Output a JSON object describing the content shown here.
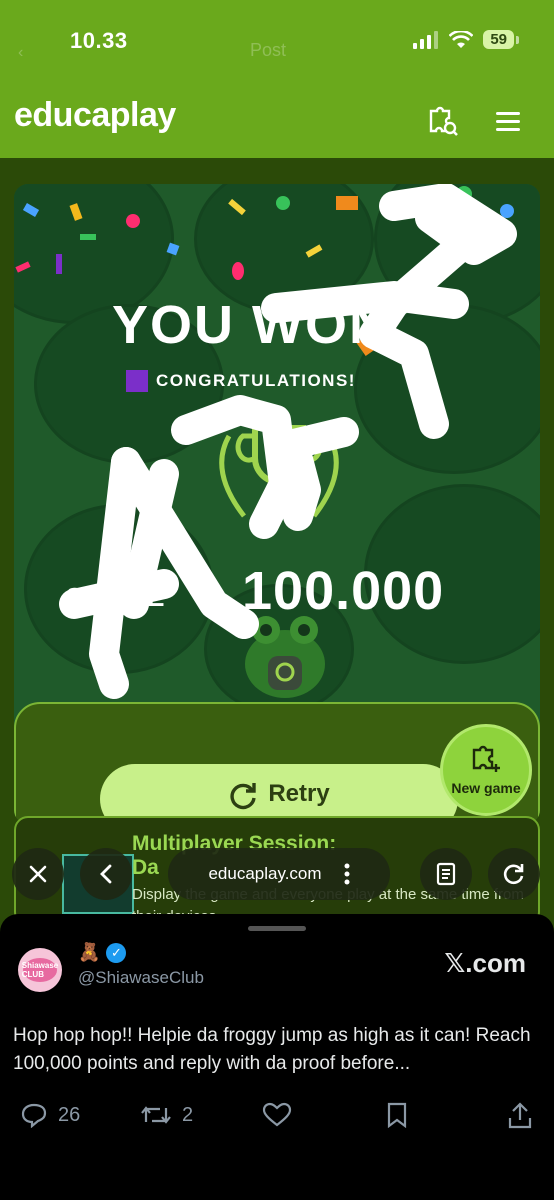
{
  "status_bar": {
    "time": "10.33",
    "battery": "59",
    "faded_text": "Post"
  },
  "header": {
    "brand": "educaplay",
    "search_icon": "puzzle-search-icon",
    "menu_icon": "hamburger-menu-icon"
  },
  "result": {
    "headline": "YOU WON",
    "congrats": "CONGRATULATIONS!",
    "score_label": "SCORE",
    "score_value": "100.000"
  },
  "actions": {
    "retry_label": "Retry",
    "new_game_label": "New game"
  },
  "multiplayer": {
    "title_line1": "Multiplayer Session:",
    "title_line2": "Da",
    "description": "Display the game and everyone play at the same time from their devices"
  },
  "browser": {
    "url": "educaplay.com"
  },
  "tweet": {
    "avatar_text": "Shiawase CLUB",
    "name_emoji": "🧸",
    "handle": "@ShiawaseClub",
    "source": "𝕏.com",
    "text": "Hop hop hop!! Helpie da froggy jump as high as it can! Reach 100,000 points and reply with da proof before...",
    "replies": "26",
    "reposts": "2"
  },
  "colors": {
    "brand_green": "#6aa91c",
    "game_bg": "#1f5a2a",
    "retry_bg": "#c8f08a",
    "link_green": "#9ad852"
  }
}
